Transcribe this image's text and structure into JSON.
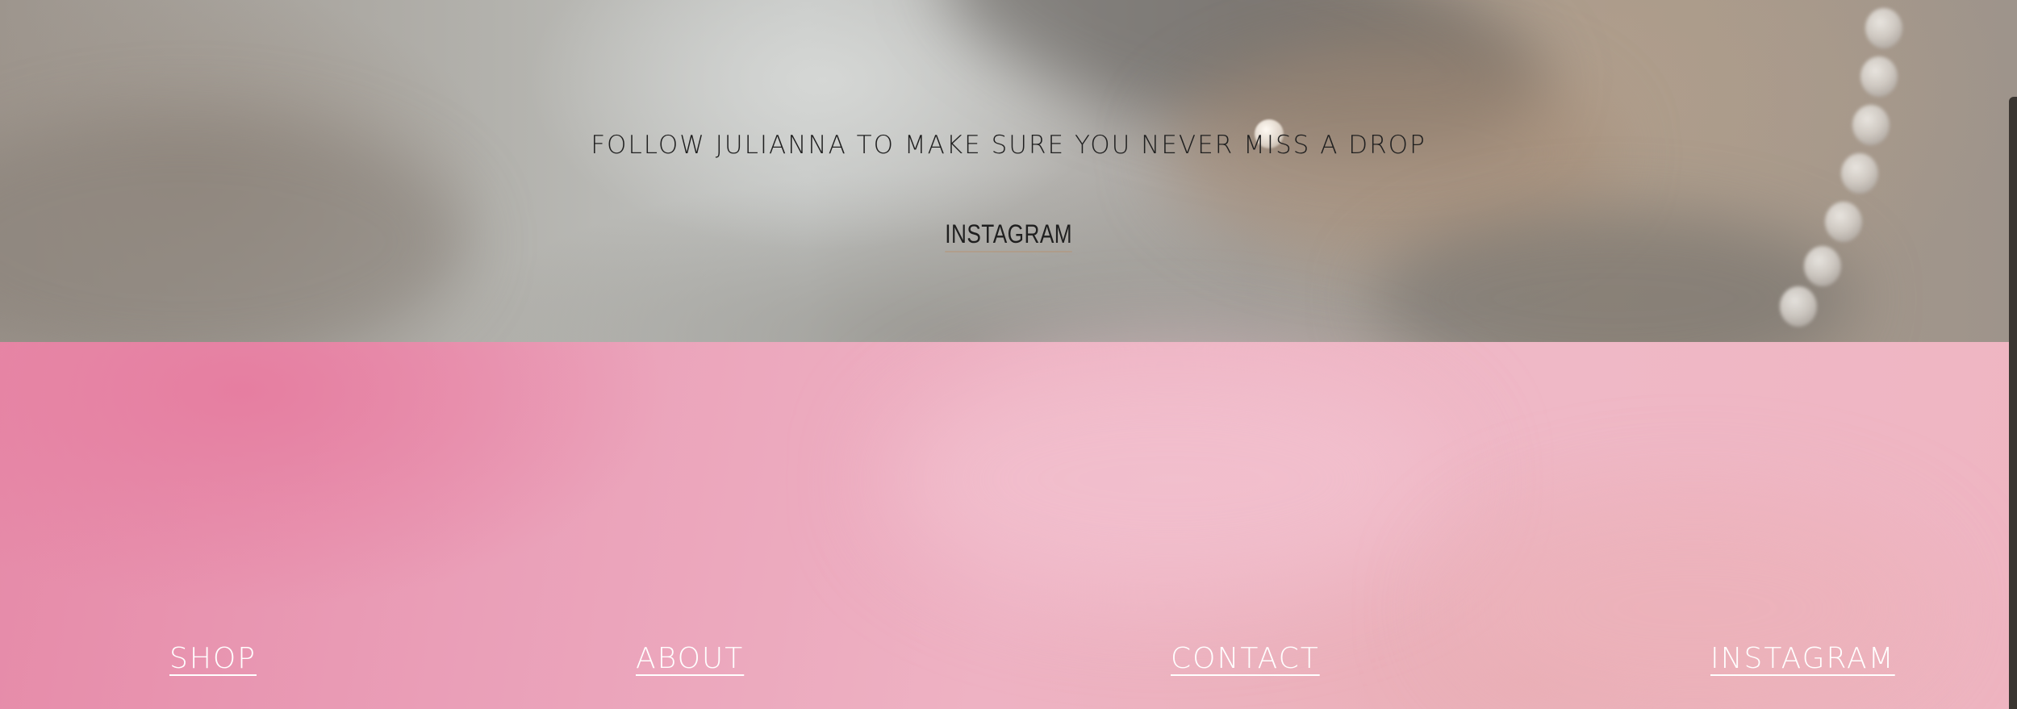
{
  "hero": {
    "follow_text": "FOLLOW JULIANNA TO MAKE SURE YOU NEVER MISS A DROP",
    "instagram_link": "INSTAGRAM"
  },
  "footer": {
    "nav": [
      {
        "label": "SHOP"
      },
      {
        "label": "ABOUT"
      },
      {
        "label": "CONTACT"
      },
      {
        "label": "INSTAGRAM"
      }
    ]
  },
  "colors": {
    "footer_pink": "#eaa3bb",
    "footer_text": "#ffffff",
    "hero_text": "#1f1f1f"
  }
}
